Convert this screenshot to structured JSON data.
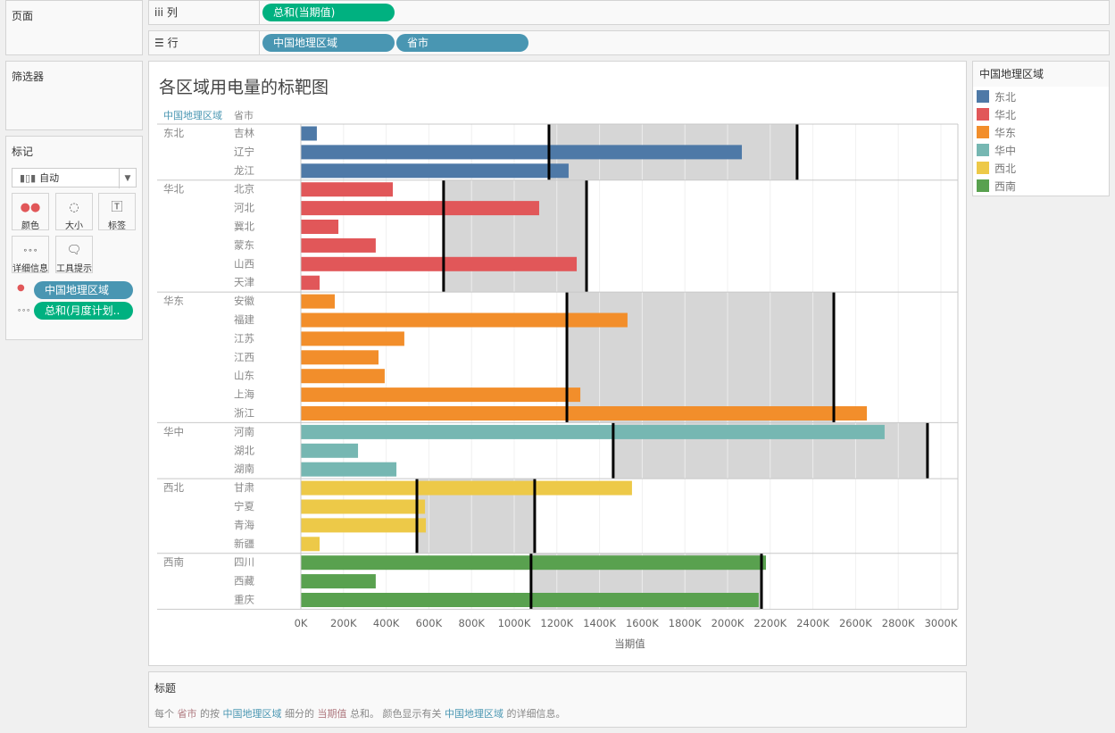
{
  "panels": {
    "pages": "页面",
    "filters": "筛选器",
    "marks": "标记"
  },
  "shelves": {
    "columns_label": "列",
    "columns_pills": [
      "总和(当期值)"
    ],
    "rows_label": "行",
    "rows_pills": [
      "中国地理区域",
      "省市"
    ]
  },
  "marks": {
    "type": "自动",
    "cards": [
      "颜色",
      "大小",
      "标签",
      "详细信息",
      "工具提示"
    ],
    "pills": [
      "中国地理区域",
      "总和(月度计划.."
    ]
  },
  "legend": {
    "title": "中国地理区域",
    "items": [
      {
        "label": "东北",
        "color": "#4e79a7"
      },
      {
        "label": "华北",
        "color": "#e15759"
      },
      {
        "label": "华东",
        "color": "#f28e2b"
      },
      {
        "label": "华中",
        "color": "#76b7b2"
      },
      {
        "label": "西北",
        "color": "#edc948"
      },
      {
        "label": "西南",
        "color": "#59a14f"
      }
    ]
  },
  "caption": {
    "title": "标题",
    "text_parts": [
      "每个 ",
      "省市",
      " 的按 ",
      "中国地理区域",
      " 细分的 ",
      "当期值",
      " 总和。 颜色显示有关 ",
      "中国地理区域",
      " 的详细信息。"
    ]
  },
  "chart_data": {
    "type": "bar",
    "title": "各区域用电量的标靶图",
    "row_headers": [
      "中国地理区域",
      "省市"
    ],
    "xlabel": "当期值",
    "xlim": [
      0,
      3000000
    ],
    "xticks": [
      "0K",
      "200K",
      "400K",
      "600K",
      "800K",
      "1000K",
      "1200K",
      "1400K",
      "1600K",
      "1800K",
      "2000K",
      "2200K",
      "2400K",
      "2600K",
      "2800K",
      "3000K"
    ],
    "grid": true,
    "groups": [
      {
        "region": "东北",
        "color": "#4e79a7",
        "ref_band": [
          1163000,
          2326000
        ],
        "rows": [
          {
            "name": "吉林",
            "value": 75000
          },
          {
            "name": "辽宁",
            "value": 2067000
          },
          {
            "name": "龙江",
            "value": 1255000
          }
        ]
      },
      {
        "region": "华北",
        "color": "#e15759",
        "ref_band": [
          669000,
          1339000
        ],
        "rows": [
          {
            "name": "北京",
            "value": 431000
          },
          {
            "name": "河北",
            "value": 1117000
          },
          {
            "name": "冀北",
            "value": 176000
          },
          {
            "name": "蒙东",
            "value": 351000
          },
          {
            "name": "山西",
            "value": 1293000
          },
          {
            "name": "天津",
            "value": 88000
          }
        ]
      },
      {
        "region": "华东",
        "color": "#f28e2b",
        "ref_band": [
          1247000,
          2498000
        ],
        "rows": [
          {
            "name": "安徽",
            "value": 159000
          },
          {
            "name": "福建",
            "value": 1531000
          },
          {
            "name": "江苏",
            "value": 485000
          },
          {
            "name": "江西",
            "value": 364000
          },
          {
            "name": "山东",
            "value": 393000
          },
          {
            "name": "上海",
            "value": 1310000
          },
          {
            "name": "浙江",
            "value": 2653000
          }
        ]
      },
      {
        "region": "华中",
        "color": "#76b7b2",
        "ref_band": [
          1464000,
          2937000
        ],
        "rows": [
          {
            "name": "河南",
            "value": 2736000
          },
          {
            "name": "湖北",
            "value": 268000
          },
          {
            "name": "湖南",
            "value": 448000
          }
        ]
      },
      {
        "region": "西北",
        "color": "#edc948",
        "ref_band": [
          544000,
          1096000
        ],
        "rows": [
          {
            "name": "甘肃",
            "value": 1552000
          },
          {
            "name": "宁夏",
            "value": 582000
          },
          {
            "name": "青海",
            "value": 586000
          },
          {
            "name": "新疆",
            "value": 88000
          }
        ]
      },
      {
        "region": "西南",
        "color": "#59a14f",
        "ref_band": [
          1079000,
          2159000
        ],
        "rows": [
          {
            "name": "四川",
            "value": 2180000
          },
          {
            "name": "西藏",
            "value": 351000
          },
          {
            "name": "重庆",
            "value": 2146000
          }
        ]
      }
    ]
  }
}
